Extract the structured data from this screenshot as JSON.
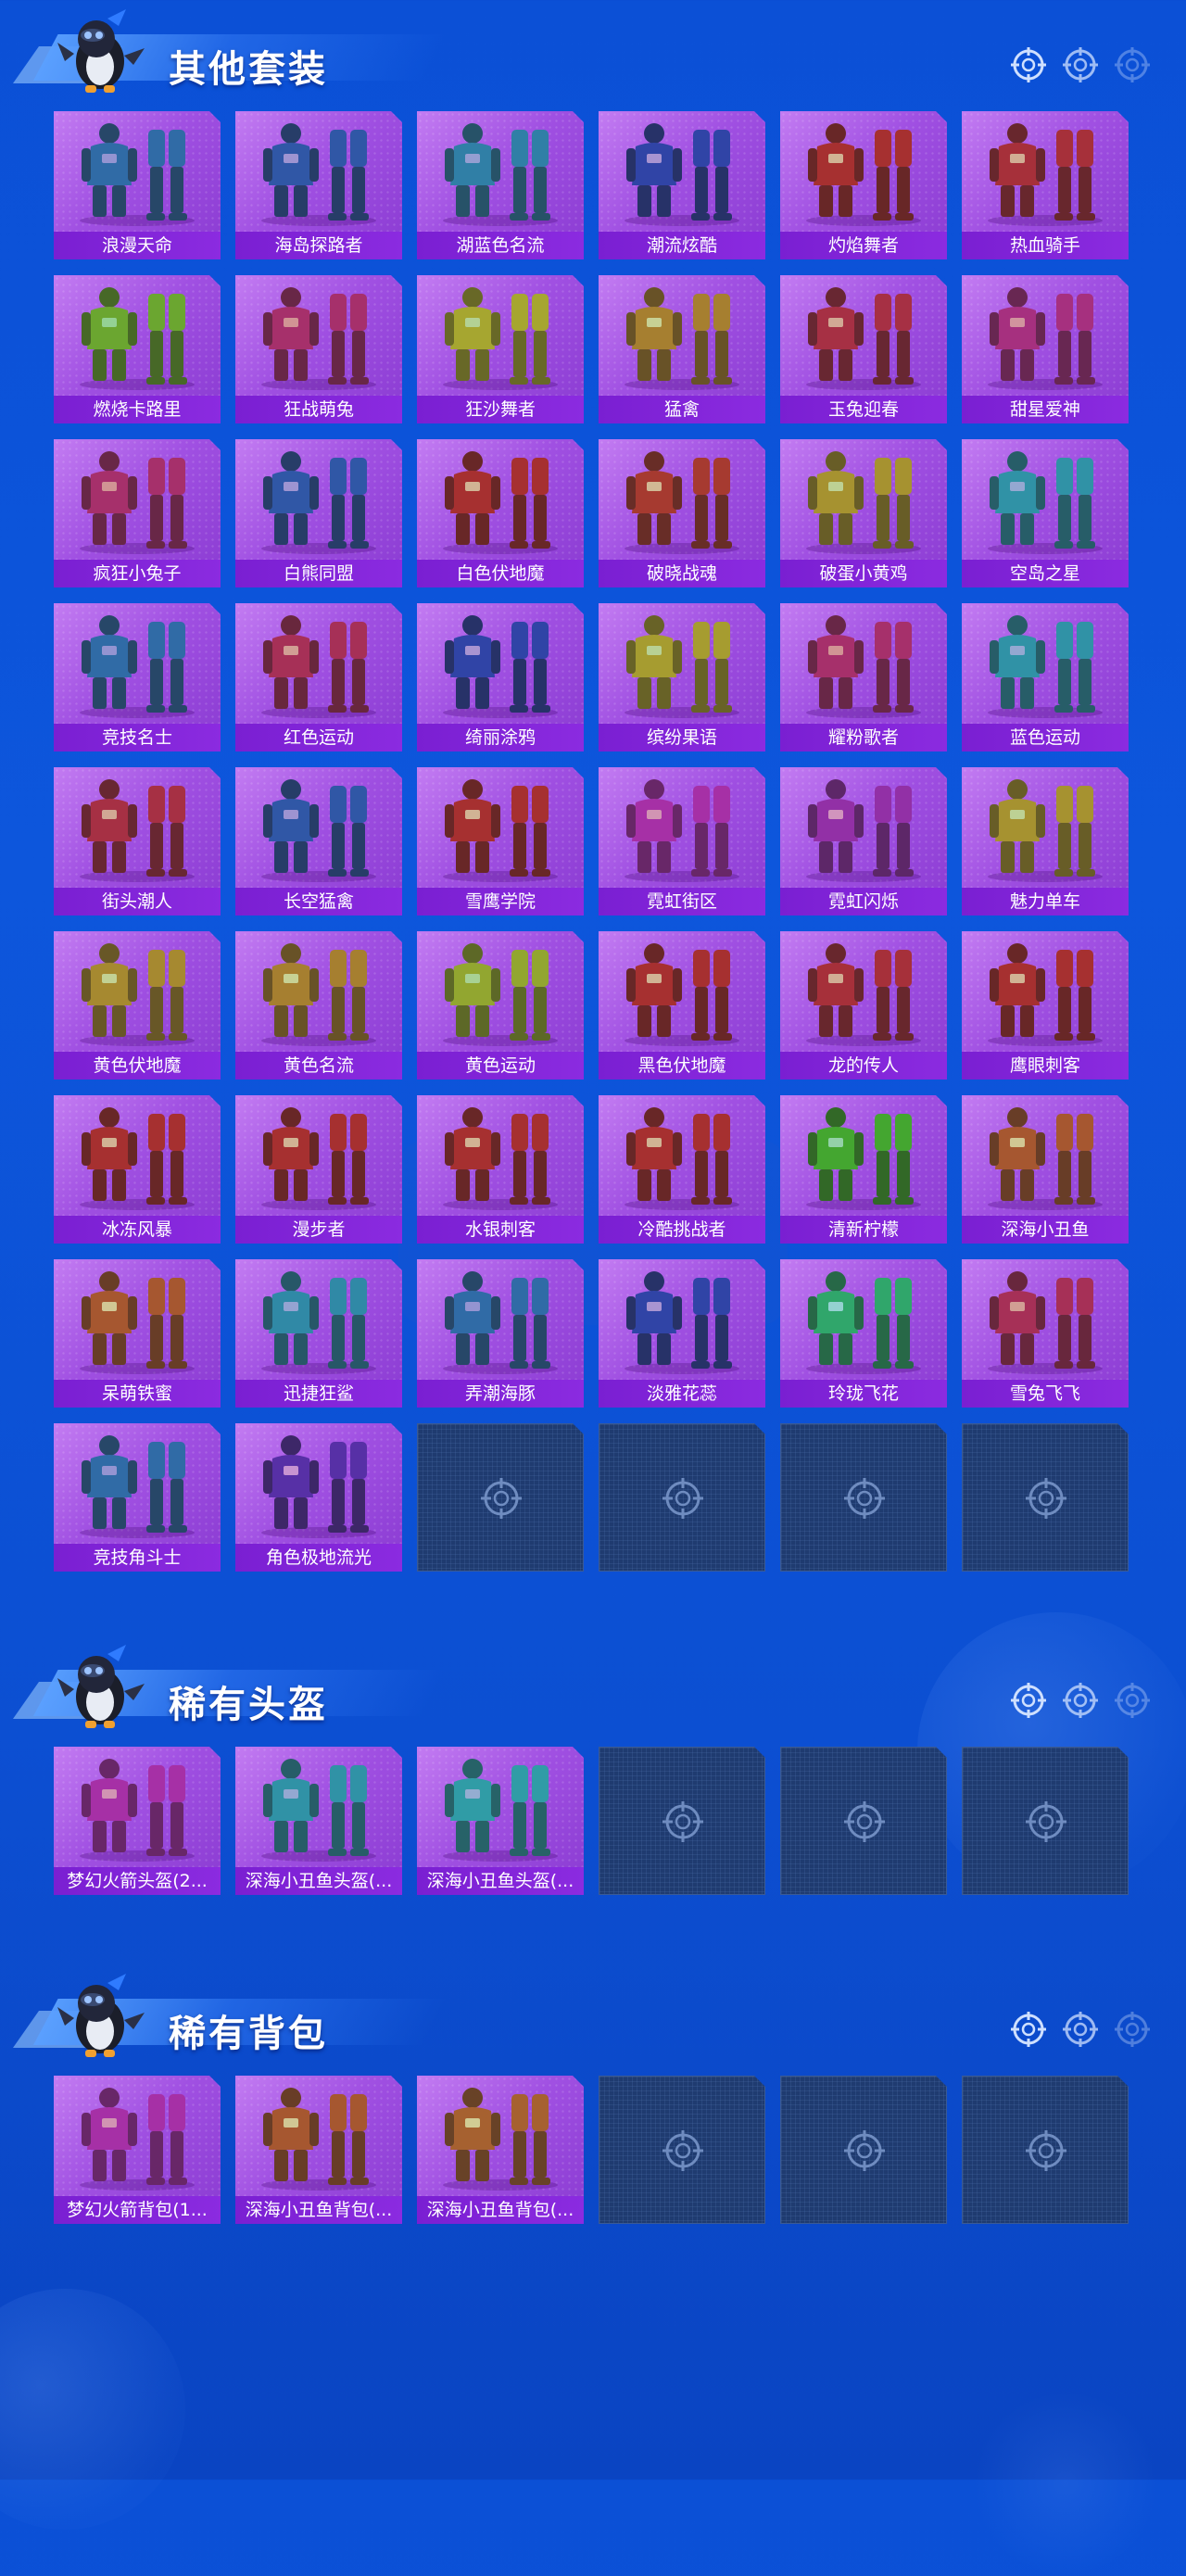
{
  "sections": [
    {
      "title": "其他套装",
      "items": [
        {
          "name": "浪漫天命",
          "hue": 210
        },
        {
          "name": "海岛探路者",
          "hue": 220
        },
        {
          "name": "湖蓝色名流",
          "hue": 200
        },
        {
          "name": "潮流炫酷",
          "hue": 230
        },
        {
          "name": "灼焰舞者",
          "hue": 0
        },
        {
          "name": "热血骑手",
          "hue": 355
        },
        {
          "name": "燃烧卡路里",
          "hue": 90
        },
        {
          "name": "狂战萌兔",
          "hue": 330
        },
        {
          "name": "狂沙舞者",
          "hue": 60
        },
        {
          "name": "猛禽",
          "hue": 40
        },
        {
          "name": "玉兔迎春",
          "hue": 350
        },
        {
          "name": "甜星爱神",
          "hue": 320
        },
        {
          "name": "疯狂小兔子",
          "hue": 330
        },
        {
          "name": "白熊同盟",
          "hue": 220
        },
        {
          "name": "白色伏地魔",
          "hue": 0
        },
        {
          "name": "破晓战魂",
          "hue": 5
        },
        {
          "name": "破蛋小黄鸡",
          "hue": 50
        },
        {
          "name": "空岛之星",
          "hue": 190
        },
        {
          "name": "竞技名士",
          "hue": 210
        },
        {
          "name": "红色运动",
          "hue": 340
        },
        {
          "name": "绮丽涂鸦",
          "hue": 230
        },
        {
          "name": "缤纷果语",
          "hue": 55
        },
        {
          "name": "耀粉歌者",
          "hue": 330
        },
        {
          "name": "蓝色运动",
          "hue": 190
        },
        {
          "name": "街头潮人",
          "hue": 350
        },
        {
          "name": "长空猛禽",
          "hue": 220
        },
        {
          "name": "雪鹰学院",
          "hue": 0
        },
        {
          "name": "霓虹街区",
          "hue": 300
        },
        {
          "name": "霓虹闪烁",
          "hue": 290
        },
        {
          "name": "魅力单车",
          "hue": 50
        },
        {
          "name": "黄色伏地魔",
          "hue": 45
        },
        {
          "name": "黄色名流",
          "hue": 40
        },
        {
          "name": "黄色运动",
          "hue": 70
        },
        {
          "name": "黑色伏地魔",
          "hue": 0
        },
        {
          "name": "龙的传人",
          "hue": 355
        },
        {
          "name": "鹰眼刺客",
          "hue": 0
        },
        {
          "name": "冰冻风暴",
          "hue": 0
        },
        {
          "name": "漫步者",
          "hue": 0
        },
        {
          "name": "水银刺客",
          "hue": 0
        },
        {
          "name": "冷酷挑战者",
          "hue": 0
        },
        {
          "name": "清新柠檬",
          "hue": 110
        },
        {
          "name": "深海小丑鱼",
          "hue": 20
        },
        {
          "name": "呆萌铁蜜",
          "hue": 20
        },
        {
          "name": "迅捷狂鲨",
          "hue": 195
        },
        {
          "name": "弄潮海豚",
          "hue": 210
        },
        {
          "name": "淡雅花蕊",
          "hue": 230
        },
        {
          "name": "玲珑飞花",
          "hue": 150
        },
        {
          "name": "雪兔飞飞",
          "hue": 340
        },
        {
          "name": "竞技角斗士",
          "hue": 210
        },
        {
          "name": "角色极地流光",
          "hue": 260
        }
      ],
      "empty_slots": 4
    },
    {
      "title": "稀有头盔",
      "items": [
        {
          "name": "梦幻火箭头盔(2...",
          "hue": 300
        },
        {
          "name": "深海小丑鱼头盔(...",
          "hue": 190
        },
        {
          "name": "深海小丑鱼头盔(...",
          "hue": 185
        }
      ],
      "empty_slots": 3
    },
    {
      "title": "稀有背包",
      "items": [
        {
          "name": "梦幻火箭背包(1...",
          "hue": 300
        },
        {
          "name": "深海小丑鱼背包(...",
          "hue": 20
        },
        {
          "name": "深海小丑鱼背包(...",
          "hue": 25
        }
      ],
      "empty_slots": 3
    }
  ],
  "icons": {
    "mascot": "penguin-mascot-icon",
    "section_marker": "crosshair-icon",
    "empty_slot": "crosshair-placeholder-icon"
  },
  "colors": {
    "background": "#0b50d6",
    "card": "#a050e2",
    "label_bar": "#7a1fd2",
    "empty_card": "#1f3b70"
  }
}
